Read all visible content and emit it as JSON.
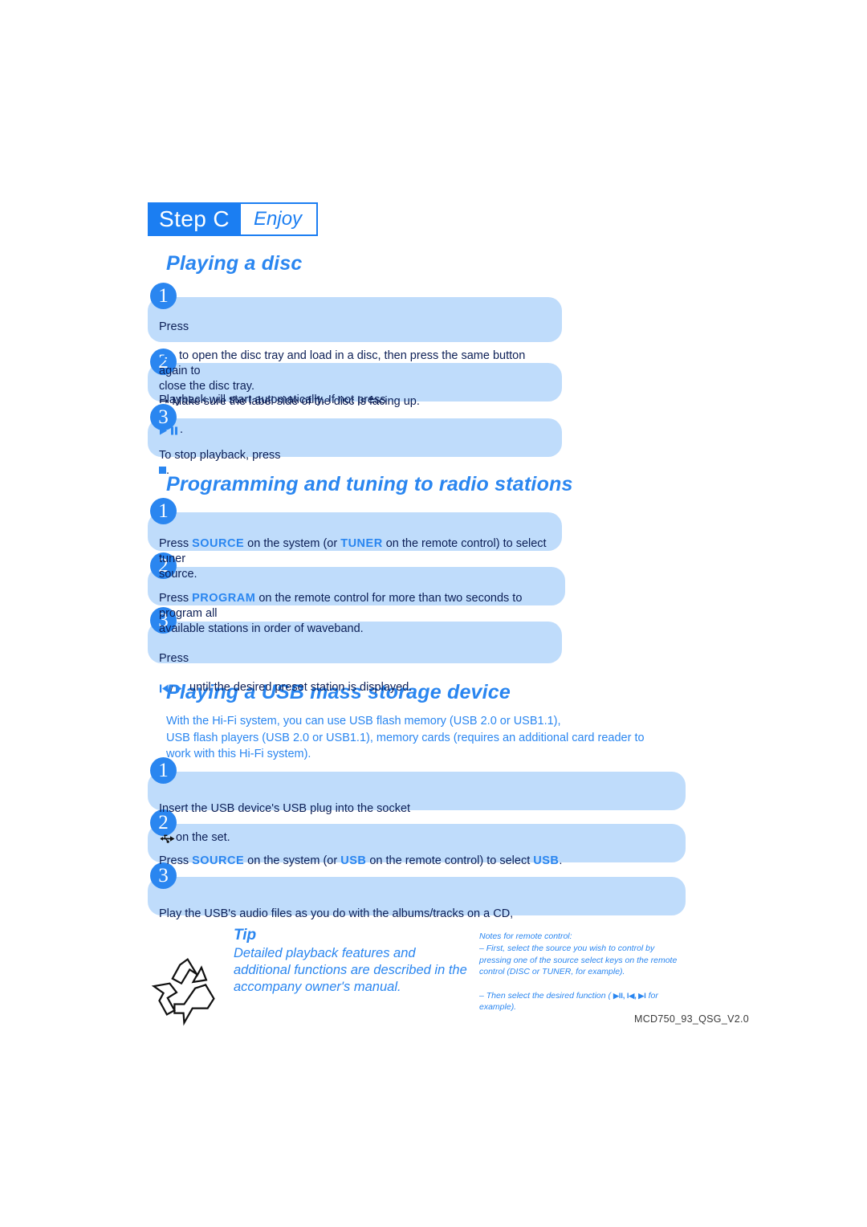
{
  "badge": {
    "step_label": "Step C",
    "step_title": "Enjoy"
  },
  "sections": [
    {
      "heading": "Playing a disc",
      "steps": [
        {
          "number": "1",
          "text_before": "Press",
          "icon": "eject-icon",
          "text_after": " to open the disc tray and load in a disc, then press the same button again to\nclose the disc tray.\n",
          "arrow_line": "Make sure the label side of the disc is facing up."
        },
        {
          "number": "2",
          "text_before": "Playback will start automatically. If not press",
          "icon": "play-pause-icon",
          "text_after": "."
        },
        {
          "number": "3",
          "text_before": "To stop playback, press",
          "icon": "stop-icon",
          "text_after": "."
        }
      ]
    },
    {
      "heading": "Programming and tuning to radio stations",
      "steps": [
        {
          "number": "1",
          "parts": [
            "Press ",
            "SOURCE",
            " on the system (or ",
            "TUNER",
            " on the remote control) to select tuner\nsource."
          ]
        },
        {
          "number": "2",
          "parts": [
            "Press ",
            "PROGRAM",
            " on the remote control for more than two seconds to program all\navailable stations in order of waveband."
          ]
        },
        {
          "number": "3",
          "text_before": "Press",
          "icon": "prev-next-icon",
          "text_after": "until the desired preset station is displayed."
        }
      ]
    },
    {
      "heading": "Playing a USB mass storage device",
      "intro": "With the Hi-Fi system, you can use USB flash memory (USB 2.0 or USB1.1),\nUSB flash players (USB 2.0 or USB1.1),  memory cards (requires an additional card reader  to\nwork with this Hi-Fi system).",
      "steps": [
        {
          "number": "1",
          "text_before": "Insert the USB device's USB plug into the socket",
          "icon": "usb-icon",
          "text_after": "on the set."
        },
        {
          "number": "2",
          "parts": [
            "Press ",
            "SOURCE",
            " on the system (or ",
            "USB",
            " on the remote control) to select ",
            "USB",
            "."
          ]
        },
        {
          "number": "3",
          "text_before": "Play the USB's audio files as you do with the albums/tracks on a CD,"
        }
      ]
    }
  ],
  "tip": {
    "title": "Tip",
    "body": "Detailed playback features and\nadditional functions are described in the\naccompany owner's manual.",
    "icon": "recycle-icon"
  },
  "notes": {
    "title": "Notes for remote control:",
    "line1": "–     First, select the source you wish to control by\npressing one of the source select keys on the remote\ncontrol (DISC or TUNER, for example).",
    "line2_before": "–     Then select the desired function ( ",
    "line2_icons": "▶II,  I◀,  ▶I",
    "line2_after": " for\nexample)."
  },
  "footer": {
    "code": "MCD750_93_QSG_V2.0"
  },
  "colors": {
    "accent_blue": "#2a86f0",
    "badge_blue": "#1b7ef2",
    "bubble_blue": "#bfdcfb",
    "body_navy": "#0c1f56",
    "footer_gray": "#3a3a3a"
  }
}
